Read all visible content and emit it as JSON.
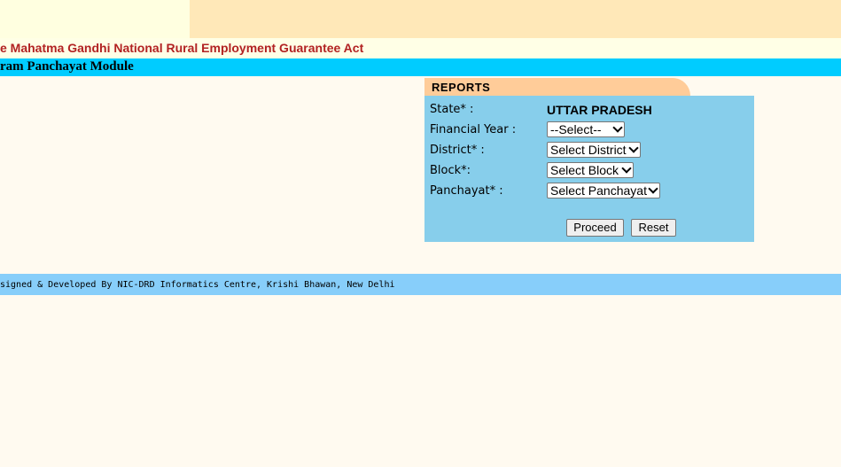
{
  "header": {
    "act_title": "e Mahatma Gandhi National Rural Employment Guarantee Act",
    "module_title": "ram Panchayat Module"
  },
  "reports": {
    "tab_label": "REPORTS",
    "state_label": "State* :",
    "state_value": "UTTAR PRADESH",
    "financial_year_label": "Financial Year :",
    "financial_year_selected": "--Select--",
    "district_label": "District* :",
    "district_selected": "Select District",
    "block_label": "Block*:",
    "block_selected": "Select Block",
    "panchayat_label": "Panchayat* :",
    "panchayat_selected": "Select Panchayat",
    "proceed_label": "Proceed",
    "reset_label": "Reset"
  },
  "footer": {
    "credit": "signed & Developed By NIC-DRD Informatics Centre, Krishi Bhawan, New Delhi"
  },
  "colors": {
    "module_bar": "#00ccff",
    "panel": "#87ceeb",
    "tab": "#ffcc99",
    "footer_bar": "#87cefa",
    "act_title": "#b22222"
  }
}
